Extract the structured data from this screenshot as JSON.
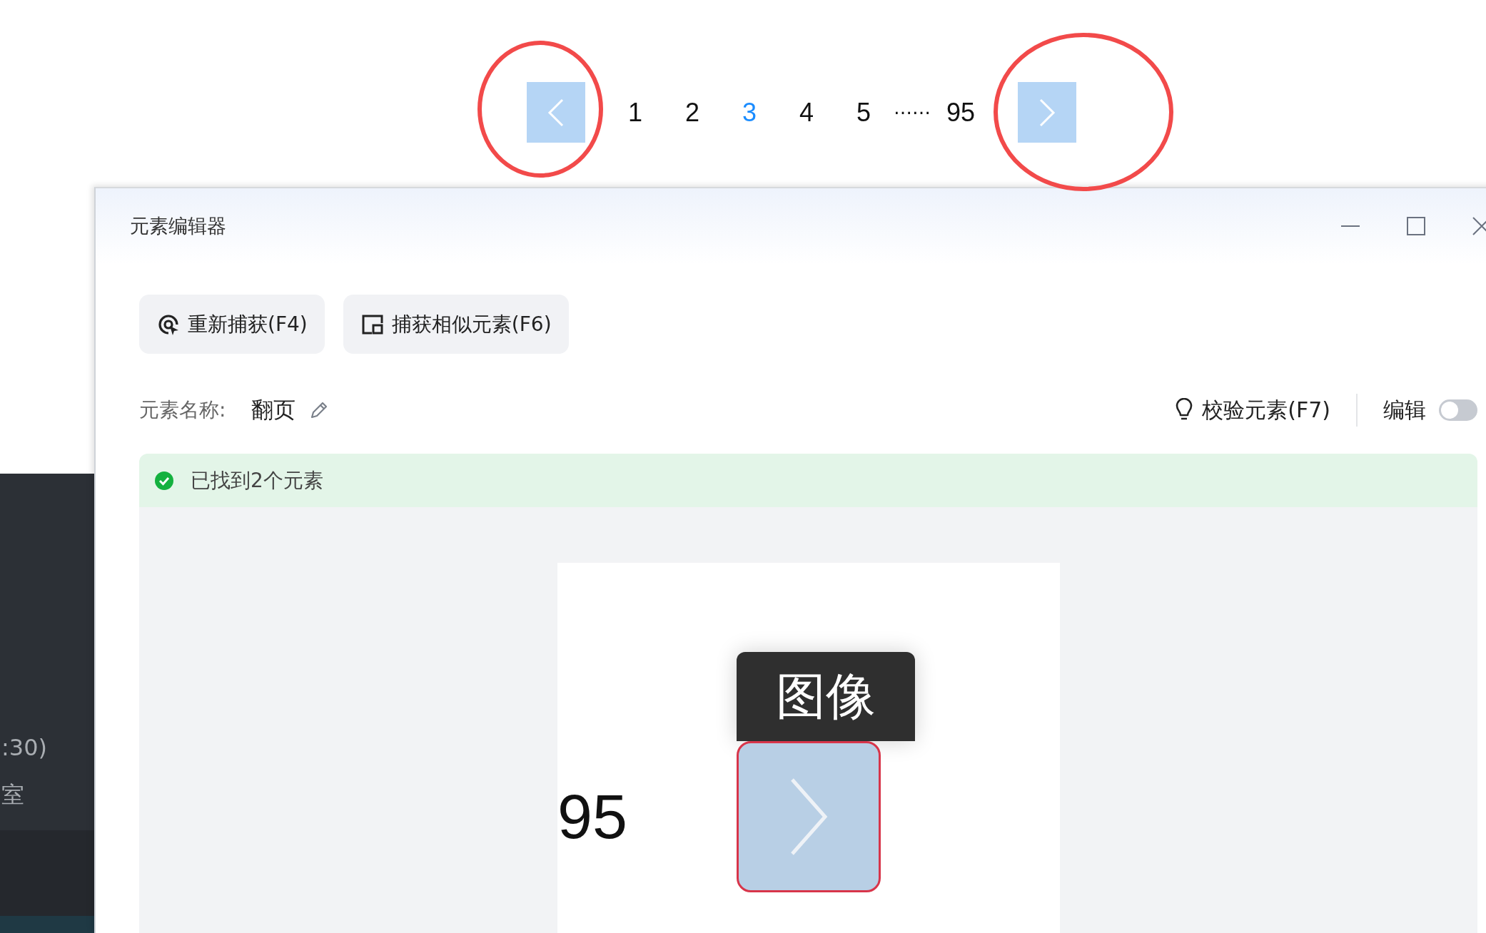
{
  "pagination": {
    "pages": [
      {
        "label": "1",
        "selected": false
      },
      {
        "label": "2",
        "selected": false
      },
      {
        "label": "3",
        "selected": true
      },
      {
        "label": "4",
        "selected": false
      },
      {
        "label": "5",
        "selected": false
      }
    ],
    "ellipsis": "……",
    "last_page": {
      "label": "95",
      "selected": false
    }
  },
  "background_panel": {
    "lines": [
      ":30)",
      "室"
    ]
  },
  "editor": {
    "title": "元素编辑器",
    "actions": [
      {
        "label": "重新捕获(F4)",
        "kind": "recapture"
      },
      {
        "label": "捕获相似元素(F6)",
        "kind": "similar"
      }
    ],
    "name_label": "元素名称:",
    "name_value": "翻页",
    "validate_button": "校验元素(F7)",
    "edit_toggle": {
      "label": "编辑",
      "on": false
    },
    "status": {
      "kind": "success",
      "text": "已找到2个元素"
    },
    "preview": {
      "number": "95",
      "tooltip": "图像"
    }
  }
}
